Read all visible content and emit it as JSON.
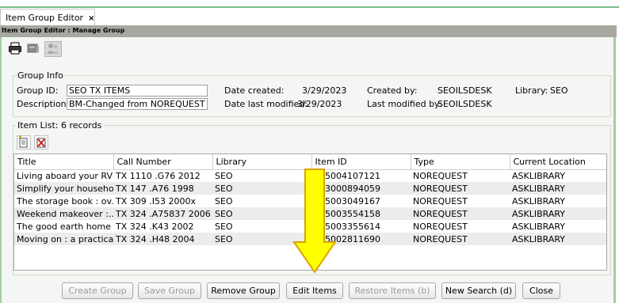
{
  "tab": {
    "label": "Item Group Editor",
    "close": "×"
  },
  "window": {
    "title": "Item Group Editor : Manage Group"
  },
  "toolbar": {
    "icons": [
      "print-icon",
      "binder-icon",
      "people-icon"
    ]
  },
  "group_info": {
    "legend": "Group Info",
    "group_id_label": "Group ID:",
    "group_id_value": "SEO TX ITEMS",
    "description_label": "Description:",
    "description_value": "BM-Changed from NOREQUEST to ASKLIBRARY",
    "date_created_label": "Date created:",
    "date_created_value": "3/29/2023",
    "date_modified_label": "Date last modified:",
    "date_modified_value": "3/29/2023",
    "created_by_label": "Created by:",
    "created_by_value": "SEOILSDESK",
    "modified_by_label": "Last modified by:",
    "modified_by_value": "SEOILSDESK",
    "library_label": "Library:",
    "library_value": "SEO"
  },
  "item_list": {
    "legend": "Item List: 6 records",
    "icons": [
      "add-item-icon",
      "remove-item-icon"
    ],
    "columns": [
      "Title",
      "Call Number",
      "Library",
      "Item ID",
      "Type",
      "Current Location"
    ],
    "rows": [
      [
        "Living aboard your RV",
        "TX 1110 .G76 2012",
        "SEO",
        "705004107121",
        "NOREQUEST",
        "ASKLIBRARY"
      ],
      [
        "Simplify your household",
        "TX 147 .A76 1998",
        "SEO",
        "503000894059",
        "NOREQUEST",
        "ASKLIBRARY"
      ],
      [
        "The storage book : ov...",
        "TX 309 .I53 2000x",
        "SEO",
        "705003049167",
        "NOREQUEST",
        "ASKLIBRARY"
      ],
      [
        "Weekend makeover :...",
        "TX 324 .A75837 2006",
        "SEO",
        "705003554158",
        "NOREQUEST",
        "ASKLIBRARY"
      ],
      [
        "The good earth home ...",
        "TX 324 .K43 2002",
        "SEO",
        "705003355614",
        "NOREQUEST",
        "ASKLIBRARY"
      ],
      [
        "Moving on : a practica...",
        "TX 324 .H48 2004",
        "SEO",
        "705002811690",
        "NOREQUEST",
        "ASKLIBRARY"
      ]
    ]
  },
  "buttons": {
    "create_group": "Create Group",
    "save_group": "Save Group",
    "remove_group": "Remove Group",
    "edit_items": "Edit Items",
    "restore_items": "Restore Items (b)",
    "new_search": "New Search (d)",
    "close": "Close"
  },
  "colors": {
    "frame_border": "#9fcf9e",
    "titlebar": "#a7a8a0",
    "arrow_fill": "#ffff00",
    "arrow_stroke": "#d9a400"
  }
}
